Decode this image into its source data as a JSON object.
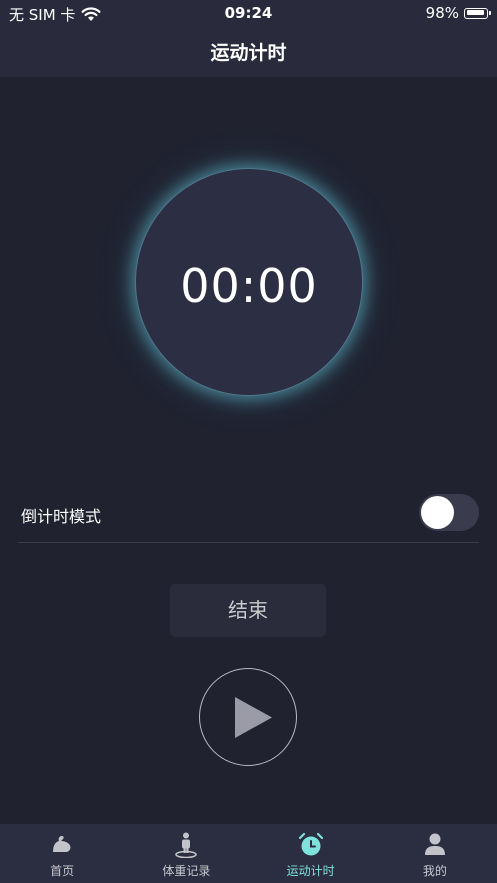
{
  "status_bar": {
    "carrier": "无 SIM 卡",
    "time": "09:24",
    "battery": "98%"
  },
  "header": {
    "title": "运动计时"
  },
  "timer": {
    "display": "00:00"
  },
  "countdown": {
    "label": "倒计时模式",
    "enabled": false
  },
  "controls": {
    "end_label": "结束",
    "play_icon": "play-icon"
  },
  "tabbar": {
    "items": [
      {
        "label": "首页",
        "icon": "arm-muscle-icon",
        "active": false
      },
      {
        "label": "体重记录",
        "icon": "scale-person-icon",
        "active": false
      },
      {
        "label": "运动计时",
        "icon": "alarm-clock-icon",
        "active": true
      },
      {
        "label": "我的",
        "icon": "user-icon",
        "active": false
      }
    ]
  },
  "colors": {
    "background": "#202230",
    "header": "#292b3c",
    "accent": "#7ee3dc",
    "glow": "#5cb2c4"
  }
}
